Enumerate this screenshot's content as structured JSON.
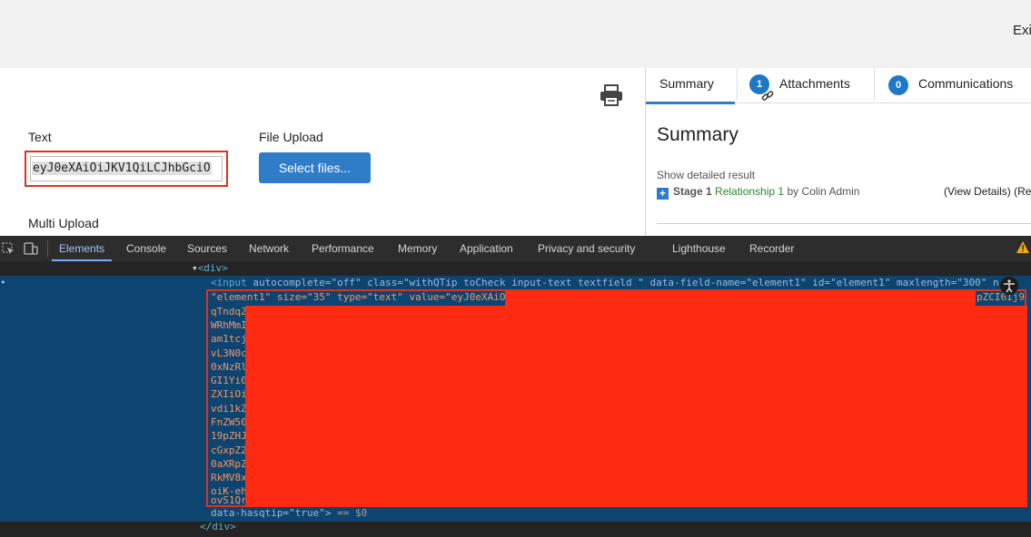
{
  "topbar": {
    "exit_label": "Exi"
  },
  "form": {
    "text_label": "Text",
    "text_value": "eyJ0eXAiOiJKV1QiLCJhbGciO",
    "file_upload_label": "File Upload",
    "select_files_label": "Select files...",
    "multi_upload_label": "Multi Upload"
  },
  "side": {
    "tabs": [
      {
        "label": "Summary"
      },
      {
        "label": "Attachments",
        "badge": "1"
      },
      {
        "label": "Communications",
        "badge": "0"
      }
    ],
    "summary_title": "Summary",
    "show_detailed": "Show detailed result",
    "stage_label": "Stage 1",
    "relationship": "Relationship 1",
    "by_text": "by Colin Admin",
    "view_details": "(View Details) (Re"
  },
  "devtools": {
    "tabs": [
      "Elements",
      "Console",
      "Sources",
      "Network",
      "Performance",
      "Memory",
      "Application",
      "Privacy and security",
      "Lighthouse",
      "Recorder"
    ],
    "active_tab": "Elements",
    "line_div_open": "<div>",
    "line_input_1_tag": "<input",
    "line_input_1_attrs": "autocomplete=\"off\" class=\"withQTip toCheck input-text textfield \" data-field-name=\"element1\" id=\"element1\" maxlength=\"300\" n",
    "line_input_2": "\"element1\" size=\"35\" type=\"text\" value=\"eyJ0eXAiO",
    "line_input_2_right": "pZCI6Ij9",
    "value_fragments": [
      "qTndqZ",
      "WRhMmI",
      "am1tcj",
      "vL3N0c",
      "0xNzRl",
      "GI1Yi0",
      "ZXIiOi",
      "vdi1kZ",
      "FnZW50",
      "19pZHJ",
      "cGxpZ2",
      "0aXRpZ",
      "RkMV8x",
      "oiK-eh",
      "ovS1Qr"
    ],
    "line_hasqtip": "data-hasqtip=\"true\">",
    "line_eq": "== $0",
    "line_div_close": "</div>"
  }
}
